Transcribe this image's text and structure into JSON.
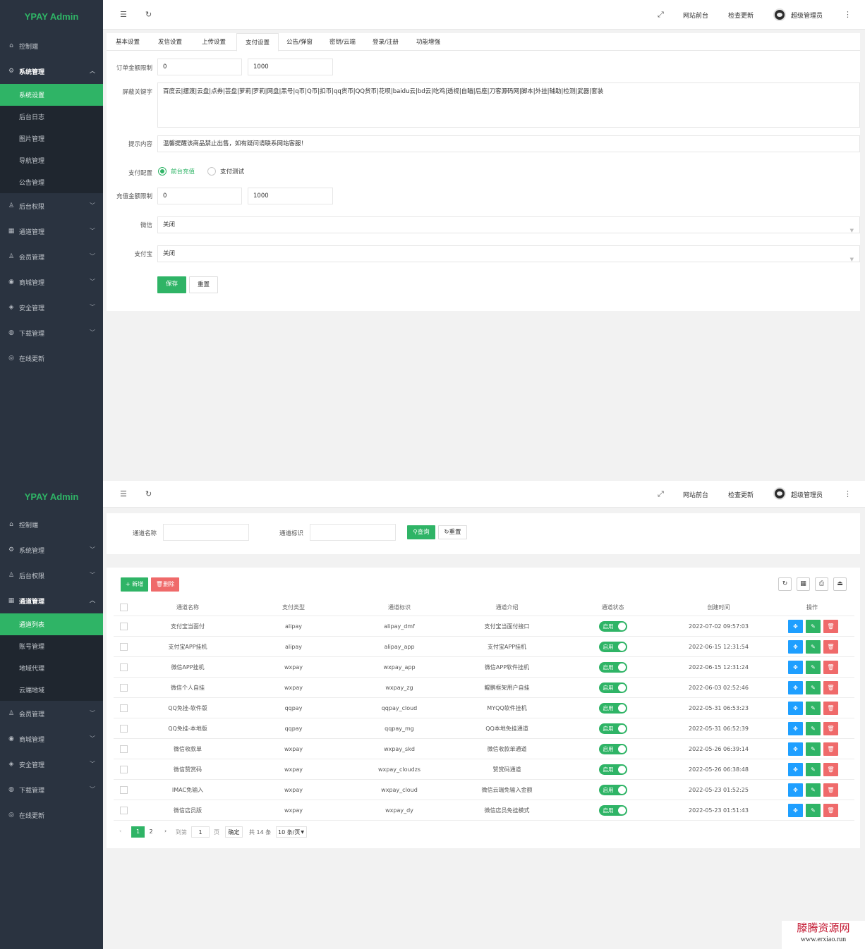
{
  "brand": "YPAY Admin",
  "topbar": {
    "front": "网站前台",
    "update": "检查更新",
    "user": "超级管理员"
  },
  "sidebar1": {
    "items": [
      {
        "icon": "home-icon",
        "glyph": "⌂",
        "label": "控制端"
      },
      {
        "icon": "gear-icon",
        "glyph": "⚙",
        "label": "系统管理"
      },
      {
        "icon": "user-icon",
        "glyph": "♙",
        "label": "后台权限"
      },
      {
        "icon": "channel-icon",
        "glyph": "▦",
        "label": "通道管理"
      },
      {
        "icon": "member-icon",
        "glyph": "♙",
        "label": "会员管理"
      },
      {
        "icon": "shop-icon",
        "glyph": "◉",
        "label": "商城管理"
      },
      {
        "icon": "shield-icon",
        "glyph": "◈",
        "label": "安全管理"
      },
      {
        "icon": "download-icon",
        "glyph": "◍",
        "label": "下载管理"
      },
      {
        "icon": "refresh-check-icon",
        "glyph": "◎",
        "label": "在线更新"
      }
    ],
    "sub": [
      "系统设置",
      "后台日志",
      "图片管理",
      "导航管理",
      "公告管理"
    ]
  },
  "sidebar2": {
    "items": [
      {
        "icon": "home-icon",
        "glyph": "⌂",
        "label": "控制端"
      },
      {
        "icon": "gear-icon",
        "glyph": "⚙",
        "label": "系统管理"
      },
      {
        "icon": "user-icon",
        "glyph": "♙",
        "label": "后台权限"
      },
      {
        "icon": "channel-icon",
        "glyph": "▦",
        "label": "通道管理"
      },
      {
        "icon": "member-icon",
        "glyph": "♙",
        "label": "会员管理"
      },
      {
        "icon": "shop-icon",
        "glyph": "◉",
        "label": "商城管理"
      },
      {
        "icon": "shield-icon",
        "glyph": "◈",
        "label": "安全管理"
      },
      {
        "icon": "download-icon",
        "glyph": "◍",
        "label": "下载管理"
      },
      {
        "icon": "refresh-check-icon",
        "glyph": "◎",
        "label": "在线更新"
      }
    ],
    "sub": [
      "通道列表",
      "账号管理",
      "地域代理",
      "云端地域"
    ]
  },
  "settings": {
    "tabs": [
      "基本设置",
      "发信设置",
      "上传设置",
      "支付设置",
      "公告/弹窗",
      "密钥/云端",
      "登录/注册",
      "功能增强"
    ],
    "order_limit_label": "订单金额限制",
    "order_min": "0",
    "order_max": "1000",
    "keywords_label": "屏蔽关键字",
    "keywords": "百度云|摆渡|云盘|点券|芸盘|萝莉|罗莉|网盘|黑号|q币|Q币|扣币|qq货币|QQ货币|花呗|baidu云|bd云|吃鸡|透视|自瞄|后座|刀客源码网|脚本|外挂|辅助|检测|武器|套装",
    "tip_label": "提示内容",
    "tip": "温馨提醒该商品禁止出售，如有疑问请联系网站客服！",
    "pay_config_label": "支付配置",
    "pay_opt1": "前台充值",
    "pay_opt2": "支付测试",
    "recharge_label": "充值金额限制",
    "recharge_min": "0",
    "recharge_max": "1000",
    "wechat_label": "微信",
    "wechat_value": "关闭",
    "alipay_label": "支付宝",
    "alipay_value": "关闭",
    "save": "保存",
    "reset": "重置"
  },
  "search": {
    "name_label": "通道名称",
    "id_label": "通道标识",
    "query": "查询",
    "reset": "重置"
  },
  "toolbar": {
    "add": "+ 新增",
    "delete": "删除"
  },
  "table": {
    "headers": [
      "通道名称",
      "支付类型",
      "通道标识",
      "通道介绍",
      "通道状态",
      "创建时间",
      "操作"
    ],
    "status_label": "启用",
    "rows": [
      [
        "支付宝当面付",
        "alipay",
        "alipay_dmf",
        "支付宝当面付接口",
        "2022-07-02 09:57:03"
      ],
      [
        "支付宝APP挂机",
        "alipay",
        "alipay_app",
        "支付宝APP挂机",
        "2022-06-15 12:31:54"
      ],
      [
        "微信APP挂机",
        "wxpay",
        "wxpay_app",
        "微信APP软件挂机",
        "2022-06-15 12:31:24"
      ],
      [
        "微信个人自挂",
        "wxpay",
        "wxpay_zg",
        "鲲鹏框架用户自挂",
        "2022-06-03 02:52:46"
      ],
      [
        "QQ免挂-软件版",
        "qqpay",
        "qqpay_cloud",
        "MYQQ软件挂机",
        "2022-05-31 06:53:23"
      ],
      [
        "QQ免挂-本地版",
        "qqpay",
        "qqpay_mg",
        "QQ本地免挂通道",
        "2022-05-31 06:52:39"
      ],
      [
        "微信收款单",
        "wxpay",
        "wxpay_skd",
        "微信收款单通道",
        "2022-05-26 06:39:14"
      ],
      [
        "微信赞赏码",
        "wxpay",
        "wxpay_cloudzs",
        "赞赏码通道",
        "2022-05-26 06:38:48"
      ],
      [
        "IMAC免输入",
        "wxpay",
        "wxpay_cloud",
        "微信云端免输入金额",
        "2022-05-23 01:52:25"
      ],
      [
        "微信店员版",
        "wxpay",
        "wxpay_dy",
        "微信店员免挂模式",
        "2022-05-23 01:51:43"
      ]
    ]
  },
  "pagination": {
    "page1": "1",
    "page2": "2",
    "goto": "到第",
    "page_input": "1",
    "page_unit": "页",
    "confirm": "确定",
    "total": "共 14 条",
    "per_page": "10 条/页"
  },
  "watermark": {
    "title": "滕腾资源网",
    "url": "www.erxiao.run"
  },
  "colors": {
    "accent": "#2fb466",
    "sidebar": "#2a3340",
    "blue": "#1e9fff",
    "red": "#ef6a6a"
  }
}
